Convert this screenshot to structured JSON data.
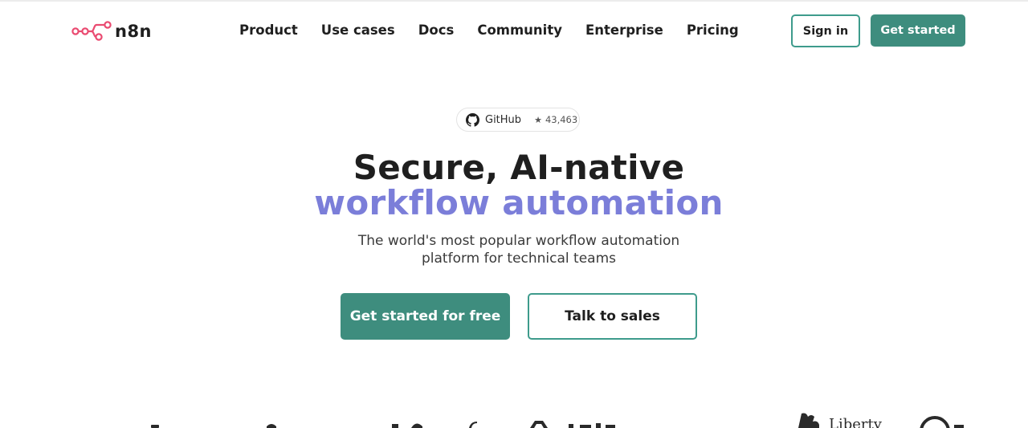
{
  "header": {
    "logo_text": "n8n",
    "nav": [
      {
        "label": "Product"
      },
      {
        "label": "Use cases"
      },
      {
        "label": "Docs"
      },
      {
        "label": "Community"
      },
      {
        "label": "Enterprise"
      },
      {
        "label": "Pricing"
      }
    ],
    "sign_in_label": "Sign in",
    "get_started_label": "Get started"
  },
  "github": {
    "label": "GitHub",
    "star_glyph": "★",
    "stars": "43,463"
  },
  "hero": {
    "title_line1": "Secure, AI-native",
    "title_line2": "workflow automation",
    "subtitle": "The world's most popular workflow automation platform for technical teams",
    "cta_primary": "Get started for free",
    "cta_secondary": "Talk to sales"
  },
  "logos_strip": {
    "partial_text": "Liberty"
  },
  "colors": {
    "accent_green": "#3e8d7e",
    "accent_purple": "#7b7ed9",
    "logo_pink": "#ea4b71"
  }
}
